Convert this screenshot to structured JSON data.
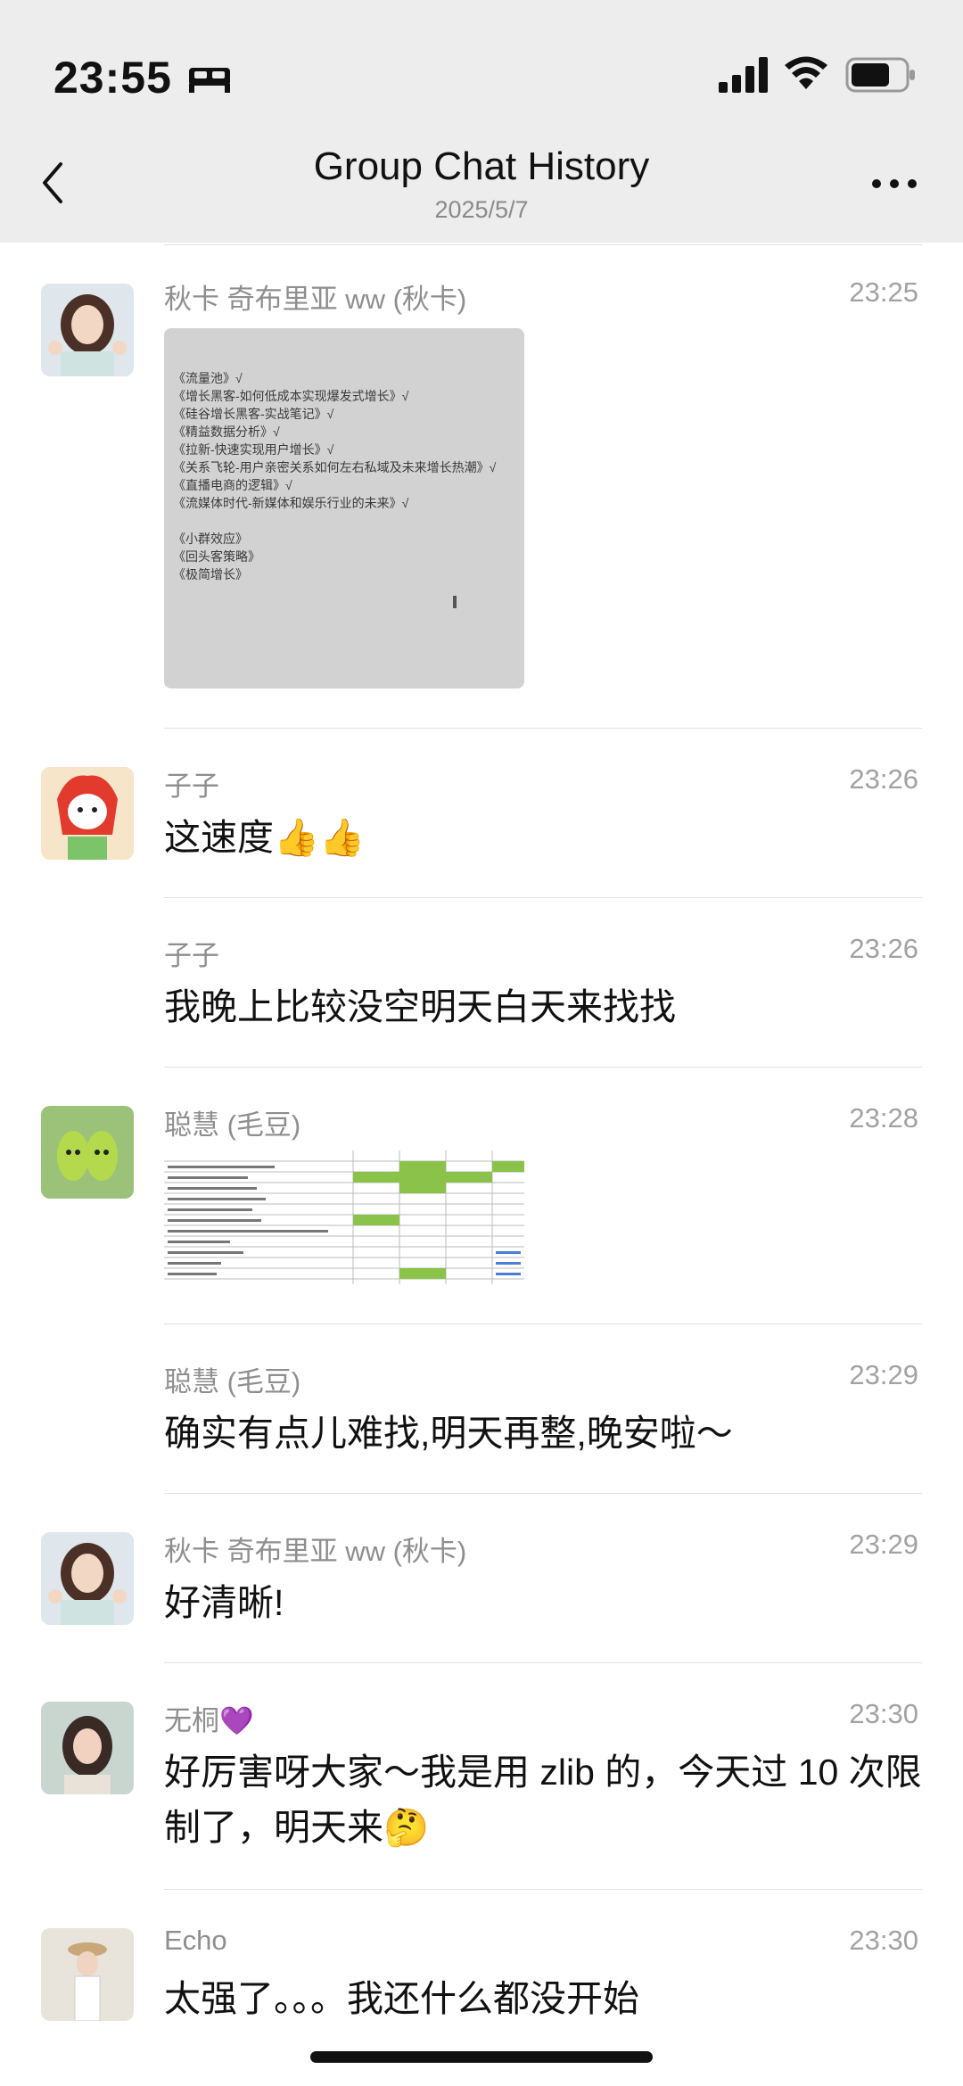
{
  "status_bar": {
    "time": "23:55"
  },
  "header": {
    "title": "Group Chat History",
    "date": "2025/5/7"
  },
  "messages": [
    {
      "sender": "秋卡 奇布里亚 ww (秋卡)",
      "time": "23:25",
      "type": "image",
      "image_text": "《流量池》√\n《增长黑客-如何低成本实现爆发式增长》√\n《硅谷增长黑客-实战笔记》√\n《精益数据分析》√\n《拉新-快速实现用户增长》√\n《关系飞轮-用户亲密关系如何左右私域及未来增长热潮》√\n《直播电商的逻辑》√\n《流媒体时代-新媒体和娱乐行业的未来》√\n\n《小群效应》\n《回头客策略》\n《极简增长》"
    },
    {
      "sender": "子子",
      "time": "23:26",
      "text": "这速度👍👍"
    },
    {
      "sender": "子子",
      "time": "23:26",
      "text": "我晚上比较没空明天白天来找找"
    },
    {
      "sender": "聪慧 (毛豆)",
      "time": "23:28",
      "type": "image"
    },
    {
      "sender": "聪慧 (毛豆)",
      "time": "23:29",
      "text": "确实有点儿难找,明天再整,晚安啦～"
    },
    {
      "sender": "秋卡 奇布里亚 ww (秋卡)",
      "time": "23:29",
      "text": "好清晰!"
    },
    {
      "sender": "无桐💜",
      "time": "23:30",
      "text": "好厉害呀大家～我是用 zlib 的，今天过 10 次限制了，明天来🤔"
    },
    {
      "sender": "Echo",
      "time": "23:30",
      "text": "太强了。。。我还什么都没开始"
    }
  ],
  "colors": {
    "header_bg": "#ededed",
    "meta_gray": "#8e8e8e",
    "thumb_green": "#8bc34a"
  }
}
